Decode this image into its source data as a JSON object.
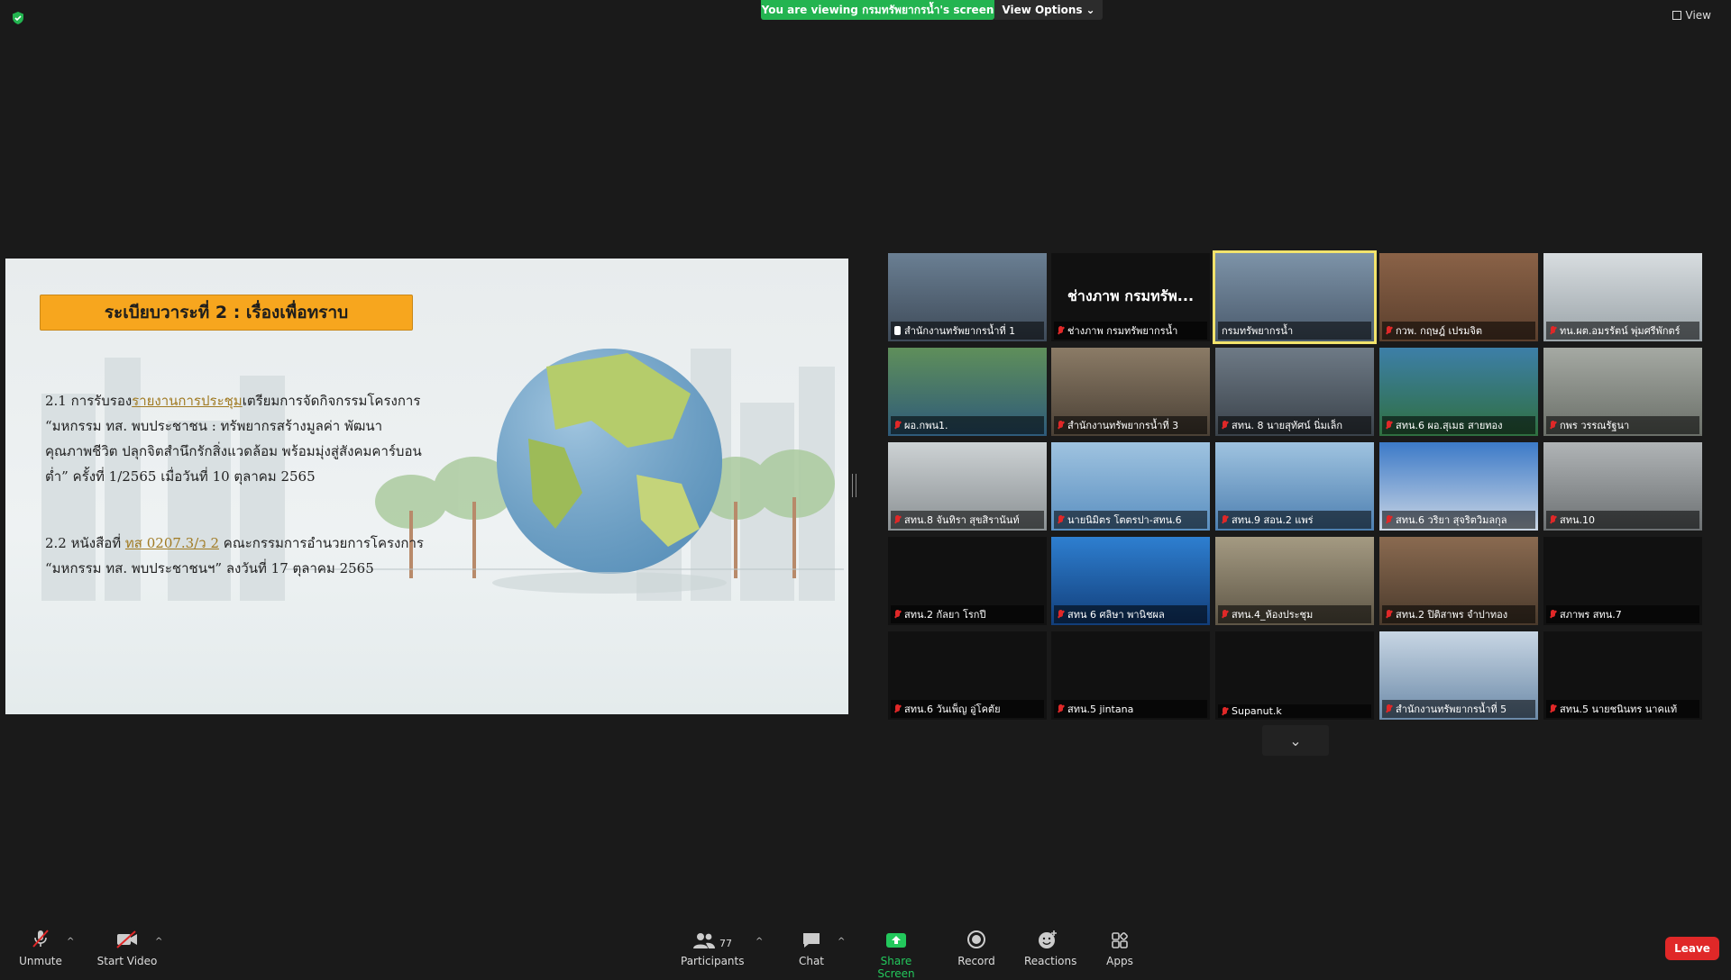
{
  "top_bar": {
    "viewing_banner": "You are viewing กรมทรัพยากรน้ำ's screen",
    "view_options": "View Options",
    "view_button": "View"
  },
  "slide": {
    "agenda_title": "ระเบียบวาระที่ 2 : เรื่องเพื่อทราบ",
    "item1_prefix": "2.1 การรับรอง",
    "item1_link": "รายงานการประชุม",
    "item1_text": "เตรียมการจัดกิจกรรมโครงการ “มหกรรม ทส. พบประชาชน : ทรัพยากรสร้างมูลค่า พัฒนาคุณภาพชีวิต ปลุกจิตสำนึกรักสิ่งแวดล้อม พร้อมมุ่งสู่สังคมคาร์บอนต่ำ” ครั้งที่ 1/2565 เมื่อวันที่ 10 ตุลาคม 2565",
    "item2_prefix": "2.2 หนังสือที่ ",
    "item2_link": "ทส 0207.3/ว 2",
    "item2_text": " คณะกรรมการอำนวยการโครงการ “มหกรรม ทส. พบประชาชนฯ” ลงวันที่ 17 ตุลาคม 2565"
  },
  "participants": [
    {
      "name": "สำนักงานทรัพยากรน้ำที่ 1",
      "status": "pinned"
    },
    {
      "name": "ช่างภาพ กรมทรัพยากรน้ำ",
      "display": "ช่างภาพ กรมทรัพ...",
      "status": "muted"
    },
    {
      "name": "กรมทรัพยากรน้ำ",
      "status": "active"
    },
    {
      "name": "กวพ. กฤษฎ์ เปรมจิต",
      "status": "muted"
    },
    {
      "name": "ทน.ผต.อมรรัตน์ พุ่มศรีพักตร์",
      "status": "muted"
    },
    {
      "name": "ผอ.กพน1.",
      "status": "muted"
    },
    {
      "name": "สำนักงานทรัพยากรน้ำที่ 3",
      "status": "muted"
    },
    {
      "name": "สทน. 8 นายสุทัศน์ นิ่มเล็ก",
      "status": "muted"
    },
    {
      "name": "สทน.6 ผอ.สุเมธ สายทอง",
      "status": "muted"
    },
    {
      "name": "กพร วรรณรัฐนา",
      "status": "muted"
    },
    {
      "name": "สทน.8 จันทิรา สุขสิรานันท์",
      "status": "muted"
    },
    {
      "name": "นายนิมิตร โตตรปา-สทน.6",
      "status": "muted"
    },
    {
      "name": "สทน.9 สอน.2 แพร่",
      "status": "muted"
    },
    {
      "name": "สทน.6 วริยา สุจริตวิมลกุล",
      "status": "muted"
    },
    {
      "name": "สทน.10",
      "status": "muted"
    },
    {
      "name": "สทน.2 กัลยา โรกปี",
      "status": "muted"
    },
    {
      "name": "สทน 6 ศลิษา พานิชผล",
      "status": "muted"
    },
    {
      "name": "สทน.4_ห้องประชุม",
      "status": "muted"
    },
    {
      "name": "สทน.2 ปิติสาพร จำปาทอง",
      "status": "muted"
    },
    {
      "name": "สภาพร สทน.7",
      "status": "muted"
    },
    {
      "name": "สทน.6 วันเพ็ญ อู่โคตัย",
      "status": "muted"
    },
    {
      "name": "สทน.5 jintana",
      "status": "muted"
    },
    {
      "name": "Supanut.k",
      "status": "muted"
    },
    {
      "name": "สำนักงานทรัพยากรน้ำที่ 5",
      "status": "muted"
    },
    {
      "name": "สทน.5 นายชนินทร นาคแท้",
      "status": "muted"
    }
  ],
  "toolbar": {
    "unmute": "Unmute",
    "start_video": "Start Video",
    "participants": "Participants",
    "participants_count": "77",
    "chat": "Chat",
    "share_screen": "Share Screen",
    "record": "Record",
    "reactions": "Reactions",
    "apps": "Apps",
    "leave": "Leave"
  }
}
